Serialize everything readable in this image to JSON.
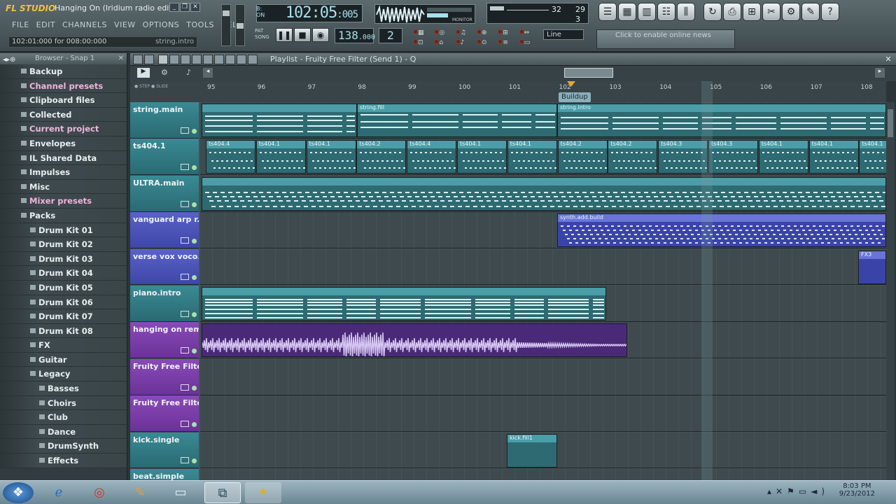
{
  "app": {
    "logo": "FL STUDIO",
    "song_title": "Hanging On (Iridium radio edit)",
    "menus": [
      "FILE",
      "EDIT",
      "CHANNELS",
      "VIEW",
      "OPTIONS",
      "TOOLS",
      "HELP"
    ],
    "hint_left": "102:01:000 for 008:00:000",
    "hint_right": "string.intro"
  },
  "transport": {
    "time": "102:05",
    "time_small": ":005",
    "time_label_top": "B:",
    "time_label_bottom": "ON",
    "tempo": "138",
    "tempo_small": ".000",
    "pattern": "2",
    "snap": "Line",
    "mode_pat": "PAT",
    "mode_song": "SONG",
    "cpu": "32",
    "poly": "3",
    "ram": "29",
    "monitor": "MONITOR",
    "news": "Click to enable online news"
  },
  "browser": {
    "title": "Browser - Snap 1",
    "items": [
      {
        "label": "Backup",
        "level": 0,
        "style": "normal"
      },
      {
        "label": "Channel presets",
        "level": 0,
        "style": "pink"
      },
      {
        "label": "Clipboard files",
        "level": 0,
        "style": "normal"
      },
      {
        "label": "Collected",
        "level": 0,
        "style": "normal"
      },
      {
        "label": "Current project",
        "level": 0,
        "style": "pink"
      },
      {
        "label": "Envelopes",
        "level": 0,
        "style": "normal"
      },
      {
        "label": "IL Shared Data",
        "level": 0,
        "style": "normal"
      },
      {
        "label": "Impulses",
        "level": 0,
        "style": "normal"
      },
      {
        "label": "Misc",
        "level": 0,
        "style": "normal"
      },
      {
        "label": "Mixer presets",
        "level": 0,
        "style": "pink"
      },
      {
        "label": "Packs",
        "level": 0,
        "style": "normal"
      },
      {
        "label": "Drum Kit 01",
        "level": 1,
        "style": "normal"
      },
      {
        "label": "Drum Kit 02",
        "level": 1,
        "style": "normal"
      },
      {
        "label": "Drum Kit 03",
        "level": 1,
        "style": "normal"
      },
      {
        "label": "Drum Kit 04",
        "level": 1,
        "style": "normal"
      },
      {
        "label": "Drum Kit 05",
        "level": 1,
        "style": "normal"
      },
      {
        "label": "Drum Kit 06",
        "level": 1,
        "style": "normal"
      },
      {
        "label": "Drum Kit 07",
        "level": 1,
        "style": "normal"
      },
      {
        "label": "Drum Kit 08",
        "level": 1,
        "style": "normal"
      },
      {
        "label": "FX",
        "level": 1,
        "style": "normal"
      },
      {
        "label": "Guitar",
        "level": 1,
        "style": "normal"
      },
      {
        "label": "Legacy",
        "level": 1,
        "style": "normal"
      },
      {
        "label": "Basses",
        "level": 2,
        "style": "normal"
      },
      {
        "label": "Choirs",
        "level": 2,
        "style": "normal"
      },
      {
        "label": "Club",
        "level": 2,
        "style": "normal"
      },
      {
        "label": "Dance",
        "level": 2,
        "style": "normal"
      },
      {
        "label": "DrumSynth",
        "level": 2,
        "style": "normal"
      },
      {
        "label": "Effects",
        "level": 2,
        "style": "normal"
      }
    ]
  },
  "playlist": {
    "title": "Playlist - Fruity Free Filter (Send 1) - Q",
    "marker": "Buildup",
    "step": "STEP",
    "slide": "SLIDE",
    "bars": [
      "95",
      "96",
      "97",
      "98",
      "99",
      "100",
      "101",
      "102",
      "103",
      "104",
      "105",
      "106",
      "107",
      "108"
    ],
    "tracks": [
      {
        "name": "string.main",
        "color": "teal"
      },
      {
        "name": "ts404.1",
        "color": "teal"
      },
      {
        "name": "ULTRA.main",
        "color": "teal"
      },
      {
        "name": "vanguard arp r...",
        "color": "blue"
      },
      {
        "name": "verse vox voco...",
        "color": "blue"
      },
      {
        "name": "piano.intro",
        "color": "teal"
      },
      {
        "name": "hanging on rem...",
        "color": "purple"
      },
      {
        "name": "Fruity Free Filte...",
        "color": "purple"
      },
      {
        "name": "Fruity Free Filte...",
        "color": "purple"
      },
      {
        "name": "kick.single",
        "color": "teal"
      },
      {
        "name": "beat.simple",
        "color": "teal"
      }
    ],
    "clip_labels": {
      "string_fill": "string.fill",
      "string_intro": "string.intro",
      "ts": [
        "ts404.4",
        "ts404.1",
        "ts404.1",
        "ts404.2",
        "ts404.4",
        "ts404.1",
        "ts404.1",
        "ts404.2",
        "ts404.2",
        "ts404.3",
        "ts404.3",
        "ts404.1",
        "ts404.1",
        "ts404.1"
      ],
      "synth": "synth.add.build",
      "fx3": "FX3",
      "kick": "kick.fill1"
    }
  },
  "taskbar": {
    "time": "8:03 PM",
    "date": "9/23/2012"
  }
}
